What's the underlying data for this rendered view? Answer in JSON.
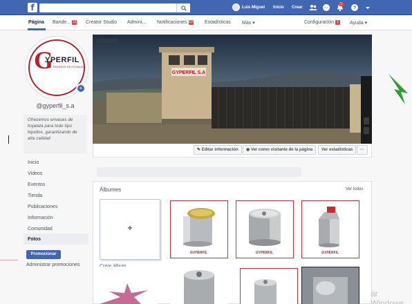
{
  "topbar": {
    "search_placeholder": "",
    "user_name": "Luis Miguel",
    "home": "Inicio",
    "create": "Crear",
    "notif_count": "1"
  },
  "pagenav": {
    "items": [
      {
        "label": "Página",
        "badge": ""
      },
      {
        "label": "Bande...",
        "badge": "12"
      },
      {
        "label": "Creator Studio",
        "badge": ""
      },
      {
        "label": "Admini...",
        "badge": ""
      },
      {
        "label": "Notificaciones",
        "badge": "10"
      },
      {
        "label": "Estadísticas",
        "badge": ""
      },
      {
        "label": "Más ▾",
        "badge": ""
      },
      {
        "label": "Configuración",
        "badge": "1"
      },
      {
        "label": "Ayuda ▾",
        "badge": ""
      }
    ]
  },
  "profile": {
    "logo_g": "G",
    "logo_name": "YPERFIL",
    "logo_tagline": "ENVASES DE HOJALATA",
    "username": "@gyperfil_s.a",
    "bio": "Ofrecemos envases de hojalata para todo tipo liquidos, garantizando de alta calidad"
  },
  "cover": {
    "building_sign": "GYPERFIL S.A",
    "actions": [
      "Editar información",
      "Ver como visitante de la página",
      "Ver estadísticas",
      "···"
    ]
  },
  "leftnav": {
    "items": [
      "Inicio",
      "Videos",
      "Eventos",
      "Tienda",
      "Publicaciones",
      "Información",
      "Comunidad",
      "Fotos"
    ],
    "promote_label": "Promocionar",
    "manage_label": "Administrar promociones"
  },
  "albums": {
    "title": "Álbumes",
    "see_all": "Ver todos",
    "create_label": "Crear álbum",
    "tile_logo_text": "GYPERFIL"
  },
  "watermark": "ar Windows",
  "colors": {
    "fb_blue": "#4267b2",
    "brand_red": "#b8202b",
    "notif_red": "#fa3e3e"
  }
}
